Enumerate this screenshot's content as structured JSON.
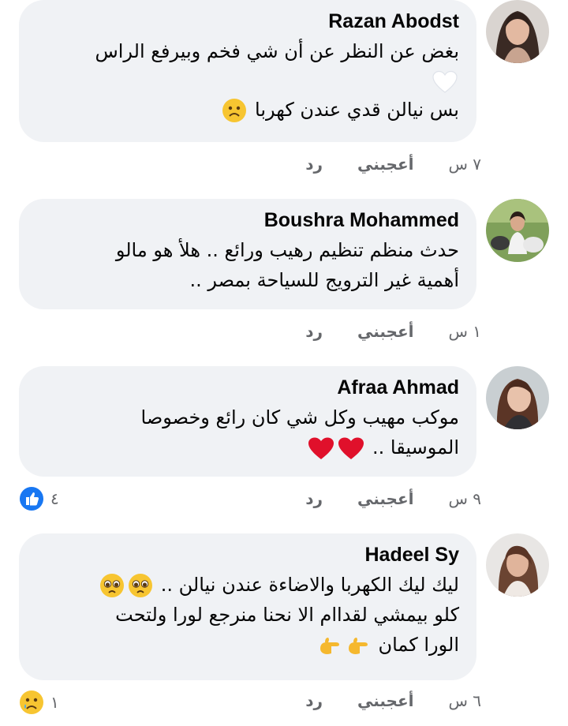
{
  "comments": [
    {
      "author": "Razan Abodst",
      "line1": "بغض عن النظر عن أن شي فخم وبيرفع الراس",
      "line2": "بس نيالن قدي عندن كهربا",
      "time": "٧ س",
      "like": "أعجبني",
      "reply": "رد",
      "avatar_icon": "woman-portrait",
      "inline_icons": [
        "white-heart-icon",
        "frowning-face-icon"
      ]
    },
    {
      "author": "Boushra Mohammed",
      "line1": "حدث منظم تنظيم رهيب ورائع .. هلأ هو مالو",
      "line2": "أهمية غير الترويج للسياحة بمصر ..",
      "time": "١ س",
      "like": "أعجبني",
      "reply": "رد",
      "avatar_icon": "woman-with-animals"
    },
    {
      "author": "Afraa Ahmad",
      "line1": "موكب مهيب وكل شي كان رائع وخصوصا",
      "line2": "الموسيقا ..",
      "time": "٩ س",
      "like": "أعجبني",
      "reply": "رد",
      "reaction_count": "٤",
      "reaction_icon": "like-thumb-icon",
      "avatar_icon": "woman-portrait",
      "inline_icons": [
        "red-heart-icon",
        "red-heart-icon"
      ]
    },
    {
      "author": "Hadeel Sy",
      "line1": "ليك ليك الكهربا والاضاءة عندن نيالن ..",
      "line2": "كلو بيمشي لقداام الا نحنا منرجع لورا ولتحت",
      "line3": "الورا كمان",
      "time": "٦ س",
      "like": "أعجبني",
      "reply": "رد",
      "reaction_count": "١",
      "reaction_icon": "sad-reaction-icon",
      "avatar_icon": "woman-portrait",
      "inline_icons": [
        "pleading-face-icon",
        "pleading-face-icon",
        "backhand-pointing-icon",
        "backhand-pointing-icon"
      ]
    }
  ],
  "colors": {
    "bubble": "#f0f2f5",
    "text": "#050505",
    "meta": "#65676b",
    "like_blue": "#1877f2",
    "heart_red": "#e0102b"
  }
}
